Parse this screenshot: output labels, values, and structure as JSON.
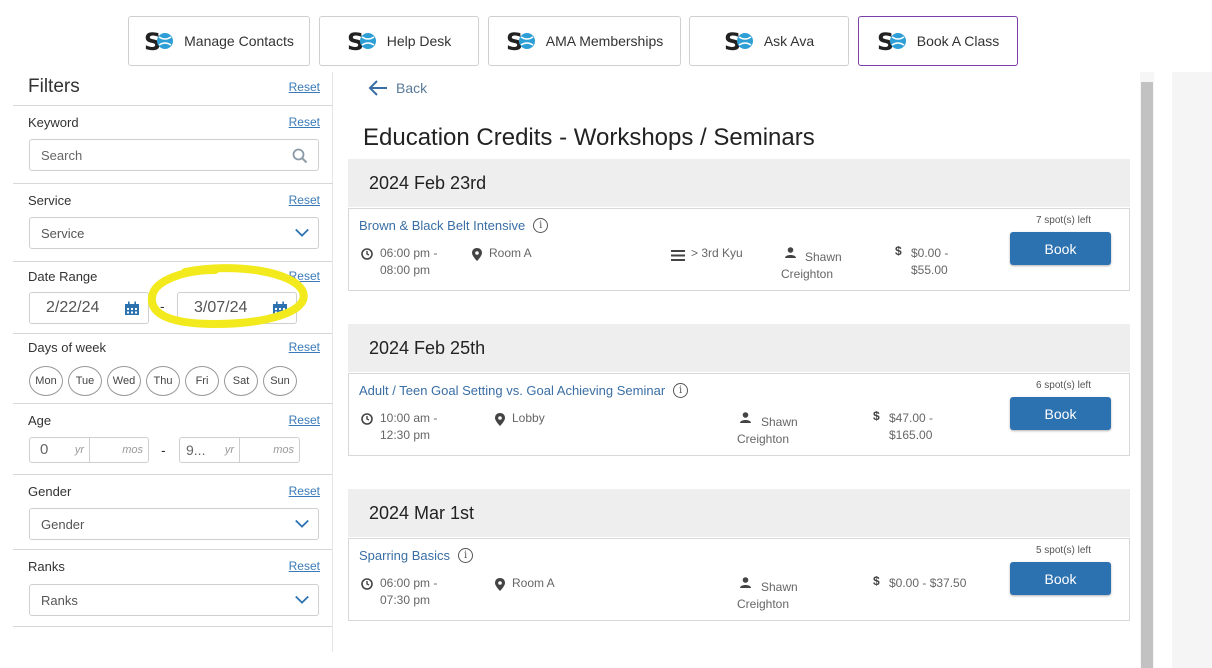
{
  "nav": {
    "buttons": [
      {
        "label": "Manage Contacts"
      },
      {
        "label": "Help Desk"
      },
      {
        "label": "AMA Memberships"
      },
      {
        "label": "Ask Ava"
      },
      {
        "label": "Book A Class"
      }
    ],
    "active": "Book A Class",
    "accent": "#7a3fa8"
  },
  "filters": {
    "title": "Filters",
    "reset_label": "Reset",
    "keyword": {
      "label": "Keyword",
      "placeholder": "Search"
    },
    "service": {
      "label": "Service",
      "value": "Service"
    },
    "date_range": {
      "label": "Date Range",
      "start": "2/22/24",
      "separator": "-",
      "end": "3/07/24"
    },
    "days": {
      "label": "Days of week",
      "items": [
        "Mon",
        "Tue",
        "Wed",
        "Thu",
        "Fri",
        "Sat",
        "Sun"
      ]
    },
    "age": {
      "label": "Age",
      "from_yr": "0",
      "from_mos": "mos",
      "to_yr": "9...",
      "to_mos": "mos",
      "yr_unit": "yr",
      "separator": "-"
    },
    "gender": {
      "label": "Gender",
      "value": "Gender"
    },
    "ranks": {
      "label": "Ranks",
      "value": "Ranks"
    }
  },
  "main": {
    "back_label": "Back",
    "title": "Education Credits - Workshops / Seminars",
    "groups": [
      {
        "date": "2024 Feb 23rd",
        "event": {
          "title": "Brown & Black Belt Intensive",
          "time_1": "06:00 pm -",
          "time_2": "08:00 pm",
          "location": "Room A",
          "rank": "> 3rd Kyu",
          "instructor_1": "Shawn",
          "instructor_2": "Creighton",
          "price_1": "$0.00 -",
          "price_2": "$55.00",
          "spots": "7 spot(s) left",
          "book_label": "Book"
        }
      },
      {
        "date": "2024 Feb 25th",
        "event": {
          "title": "Adult / Teen Goal Setting vs. Goal Achieving Seminar",
          "time_1": "10:00 am -",
          "time_2": "12:30 pm",
          "location": "Lobby",
          "instructor_1": "Shawn",
          "instructor_2": "Creighton",
          "price_1": "$47.00 -",
          "price_2": "$165.00",
          "spots": "6 spot(s) left",
          "book_label": "Book"
        }
      },
      {
        "date": "2024 Mar 1st",
        "event": {
          "title": "Sparring Basics",
          "time_1": "06:00 pm -",
          "time_2": "07:30 pm",
          "location": "Room A",
          "instructor_1": "Shawn",
          "instructor_2": "Creighton",
          "price_1": "$0.00 - $37.50",
          "price_2": "",
          "spots": "5 spot(s) left",
          "book_label": "Book"
        }
      }
    ]
  },
  "colors": {
    "link": "#3a6ea5",
    "book_button": "#2d72b0",
    "highlight": "#f2ea1c"
  }
}
